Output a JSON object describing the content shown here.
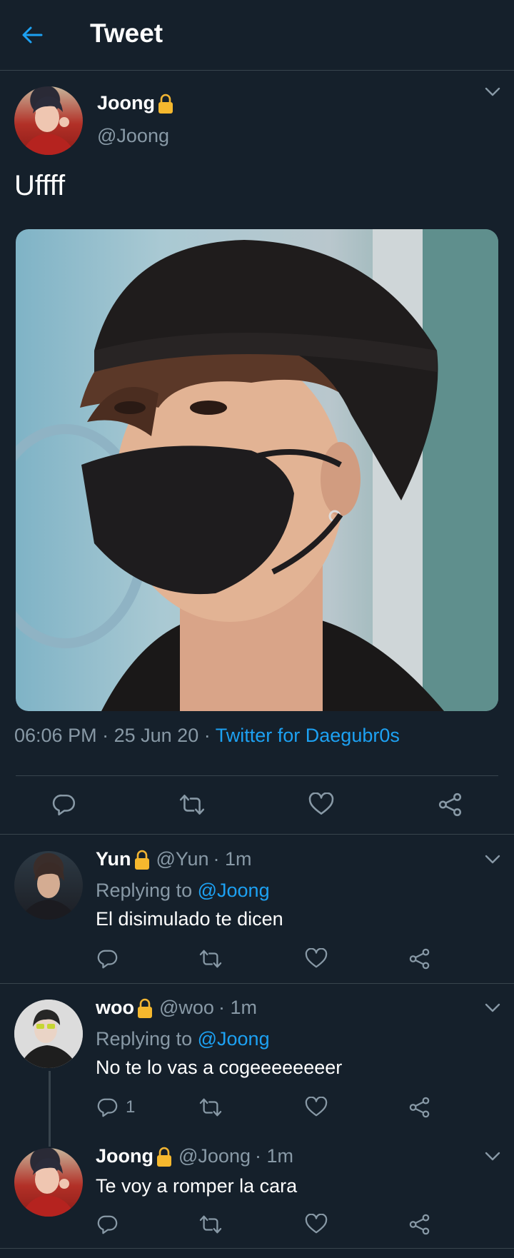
{
  "header": {
    "title": "Tweet"
  },
  "main_tweet": {
    "name": "Joong",
    "handle": "@Joong",
    "text": "Uffff",
    "time": "06:06 PM",
    "sep1": "·",
    "date": "25 Jun 20",
    "sep2": "·",
    "source": "Twitter for Daegubr0s"
  },
  "replies": [
    {
      "name": "Yun",
      "handle": "@Yun",
      "time": "· 1m",
      "replying_prefix": "Replying to",
      "replying_handle": "@Joong",
      "text": "El disimulado te dicen",
      "reply_count": ""
    },
    {
      "name": "woo",
      "handle": "@woo",
      "time": "· 1m",
      "replying_prefix": "Replying to",
      "replying_handle": "@Joong",
      "text": "No te lo vas a cogeeeeeeeer",
      "reply_count": "1"
    },
    {
      "name": "Joong",
      "handle": "@Joong",
      "time": "· 1m",
      "text": "Te voy a romper la cara",
      "reply_count": ""
    }
  ],
  "colors": {
    "background": "#15202b",
    "accent": "#1da1f2",
    "muted": "#8899a6",
    "divider": "#38444d"
  },
  "icons": [
    "back-arrow-icon",
    "lock-icon",
    "chevron-down-icon",
    "reply-icon",
    "retweet-icon",
    "like-icon",
    "share-icon"
  ]
}
